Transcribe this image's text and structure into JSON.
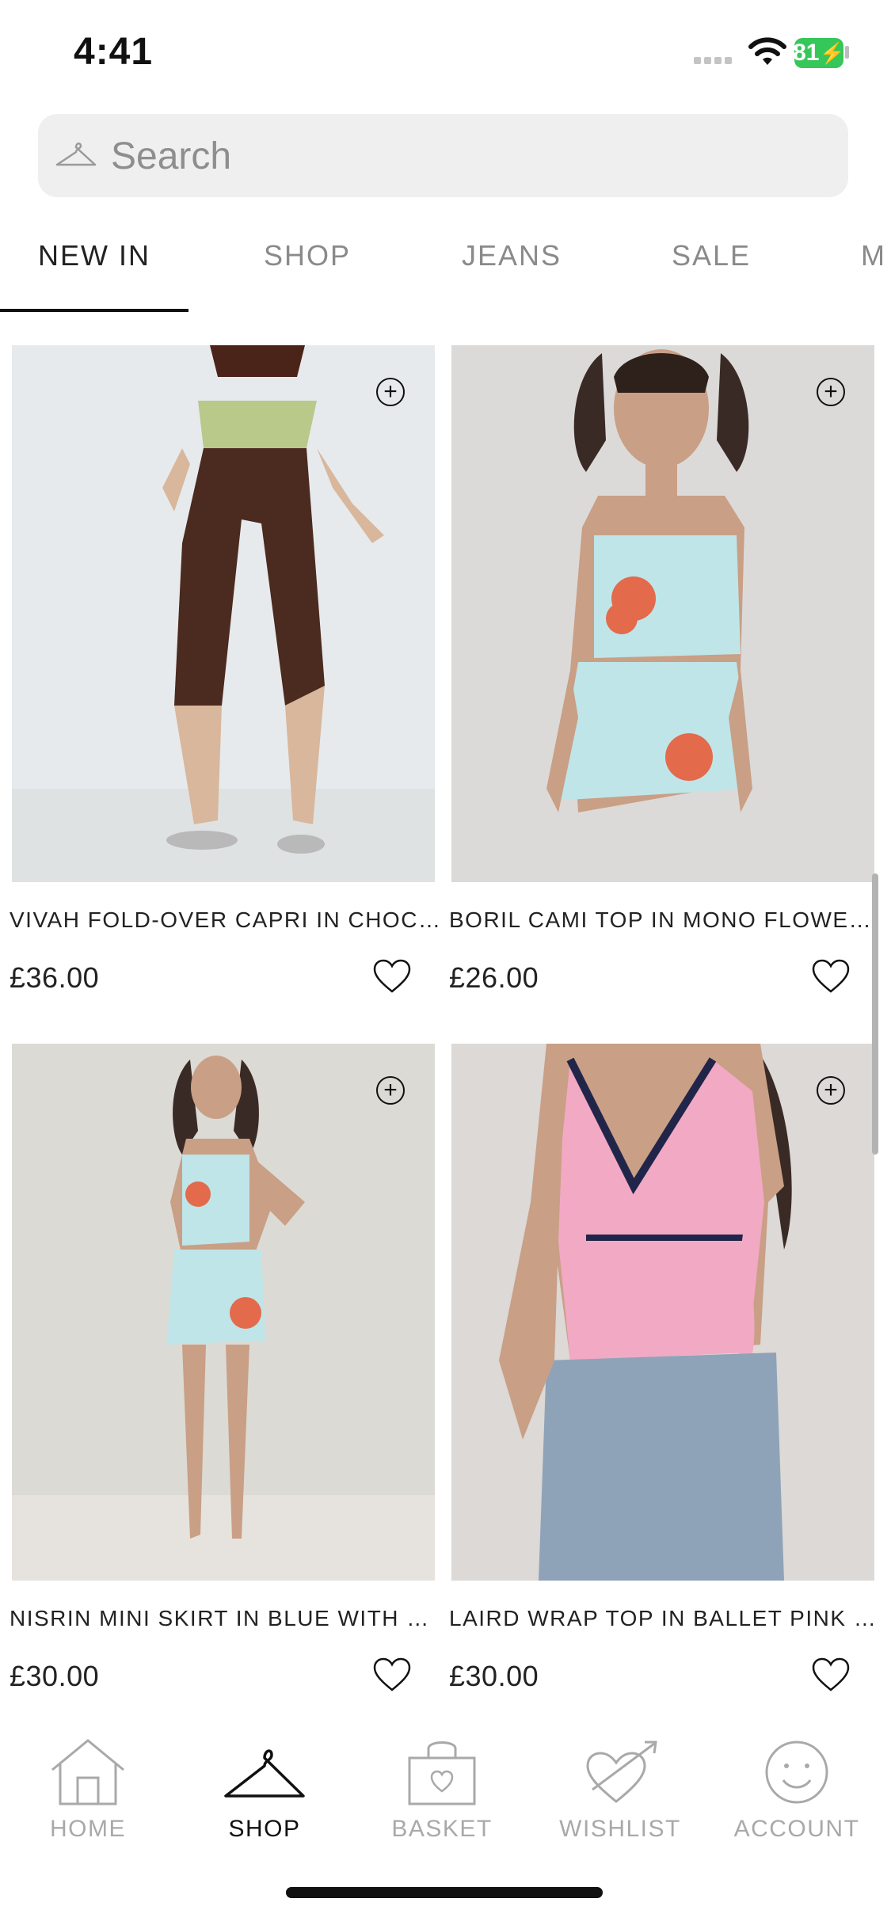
{
  "status_bar": {
    "time": "4:41",
    "battery": "81"
  },
  "search": {
    "placeholder": "Search"
  },
  "tabs": [
    {
      "label": "NEW IN",
      "active": true
    },
    {
      "label": "SHOP"
    },
    {
      "label": "JEANS"
    },
    {
      "label": "SALE"
    },
    {
      "label": "M"
    }
  ],
  "products": [
    {
      "title": "VIVAH FOLD-OVER CAPRI IN CHOCOL...",
      "price": "£36.00"
    },
    {
      "title": "BORIL CAMI TOP IN MONO FLOWER...",
      "price": "£26.00"
    },
    {
      "title": "NISRIN MINI SKIRT IN BLUE WITH OR...",
      "price": "£30.00"
    },
    {
      "title": "LAIRD WRAP TOP IN BALLET PINK WI...",
      "price": "£30.00"
    }
  ],
  "nav": [
    {
      "label": "HOME",
      "icon": "house-icon"
    },
    {
      "label": "SHOP",
      "icon": "hanger-icon",
      "active": true
    },
    {
      "label": "BASKET",
      "icon": "basket-icon"
    },
    {
      "label": "WISHLIST",
      "icon": "heart-arrow-icon"
    },
    {
      "label": "ACCOUNT",
      "icon": "smiley-icon"
    }
  ],
  "colors": {
    "accent": "#111111",
    "inactive": "#a9a9a9",
    "battery": "#35c759",
    "search_bg": "#efefef"
  }
}
